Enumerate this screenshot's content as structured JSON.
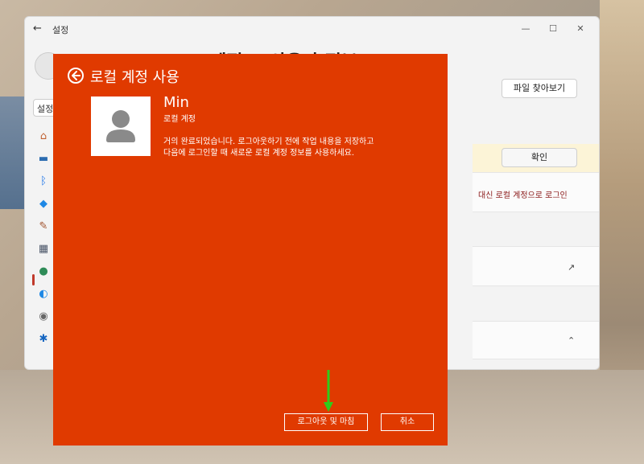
{
  "settings": {
    "title": "설정",
    "window_controls": [
      "—",
      "☐",
      "✕"
    ],
    "page_heading": "계정 > 사용자 정보",
    "search_placeholder": "설정",
    "browse_button": "파일 찾아보기",
    "confirm_button": "확인",
    "local_account_link": "대신 로컬 계정으로 로그인"
  },
  "dialog": {
    "title": "로컬 계정 사용",
    "user_name": "Min",
    "account_type": "로컬 계정",
    "message_line1": "거의 완료되었습니다. 로그아웃하기 전에 작업 내용을 저장하고",
    "message_line2": "다음에 로그인할 때 새로운 로컬 계정 정보를 사용하세요.",
    "signout_button": "로그아웃 및 마침",
    "cancel_button": "취소"
  },
  "colors": {
    "dialog_bg": "#e03a00",
    "annotation_arrow": "#2ecc1b"
  },
  "icons": [
    "back-arrow-icon",
    "home-icon",
    "system-icon",
    "bluetooth-icon",
    "network-icon",
    "personalization-icon",
    "apps-icon",
    "accounts-icon",
    "time-language-icon",
    "gaming-icon",
    "accessibility-icon",
    "external-link-icon",
    "chevron-up-icon",
    "user-avatar-icon"
  ]
}
